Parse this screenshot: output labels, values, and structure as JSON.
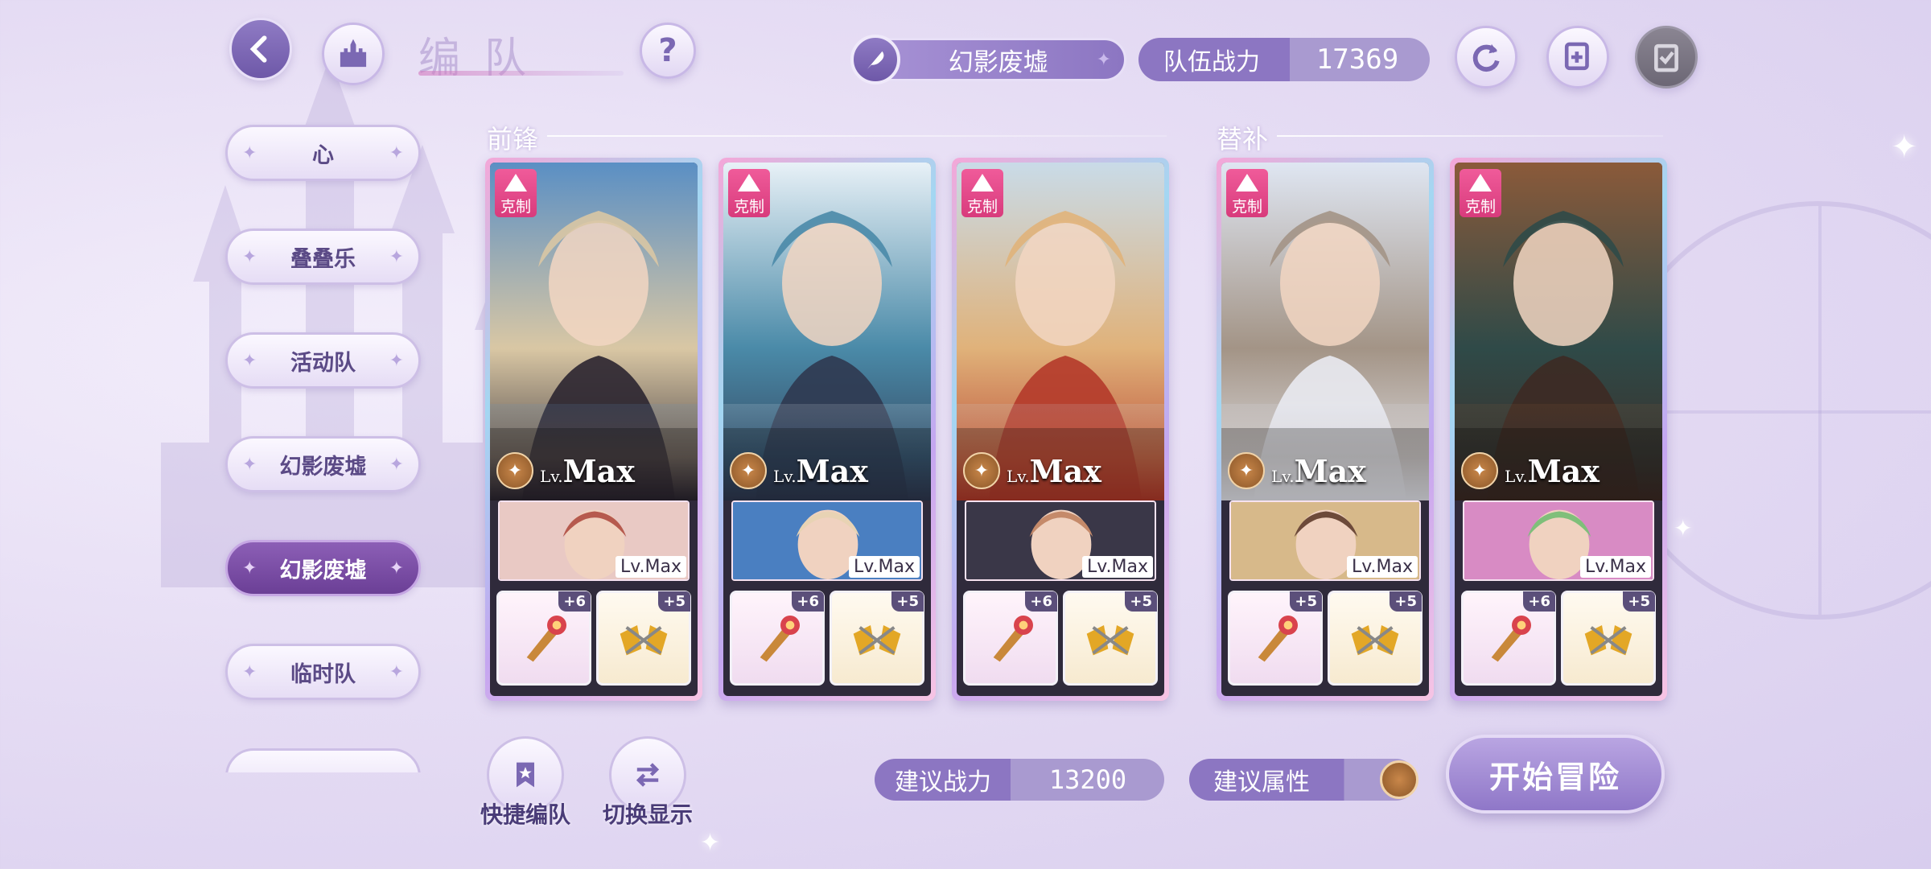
{
  "header": {
    "title": "编队",
    "stage_name": "幻影废墟",
    "power_label": "队伍战力",
    "power_value": "17369"
  },
  "sidebar": {
    "teams": [
      {
        "label": "心",
        "active": false
      },
      {
        "label": "叠叠乐",
        "active": false
      },
      {
        "label": "活动队",
        "active": false
      },
      {
        "label": "幻影废墟",
        "active": false
      },
      {
        "label": "幻影废墟",
        "active": true
      },
      {
        "label": "临时队",
        "active": false
      }
    ]
  },
  "sections": {
    "front_label": "前锋",
    "sub_label": "替补"
  },
  "cards": [
    {
      "badge": "克制",
      "lv_prefix": "Lv.",
      "lv_value": "Max",
      "support_lv": "Lv.Max",
      "equip1_lv": "+6",
      "equip2_lv": "+5",
      "portrait_colors": [
        "#5a8fc4",
        "#d9c7a4",
        "#2b2530"
      ],
      "support_colors": [
        "#e9c9c4",
        "#b65a4e"
      ]
    },
    {
      "badge": "克制",
      "lv_prefix": "Lv.",
      "lv_value": "Max",
      "support_lv": "Lv.Max",
      "equip1_lv": "+6",
      "equip2_lv": "+5",
      "portrait_colors": [
        "#e8f1f7",
        "#4a8aa8",
        "#2f3850"
      ],
      "support_colors": [
        "#4a7fc1",
        "#e8d3b4"
      ]
    },
    {
      "badge": "克制",
      "lv_prefix": "Lv.",
      "lv_value": "Max",
      "support_lv": "Lv.Max",
      "equip1_lv": "+6",
      "equip2_lv": "+5",
      "portrait_colors": [
        "#c9dbe8",
        "#e0b27a",
        "#b43a2a"
      ],
      "support_colors": [
        "#3a3748",
        "#c58a6a"
      ]
    },
    {
      "badge": "克制",
      "lv_prefix": "Lv.",
      "lv_value": "Max",
      "support_lv": "Lv.Max",
      "equip1_lv": "+5",
      "equip2_lv": "+5",
      "portrait_colors": [
        "#dfe6f2",
        "#a39486",
        "#e9eaf1"
      ],
      "support_colors": [
        "#d7b98a",
        "#6d4a3a"
      ]
    },
    {
      "badge": "克制",
      "lv_prefix": "Lv.",
      "lv_value": "Max",
      "support_lv": "Lv.Max",
      "equip1_lv": "+6",
      "equip2_lv": "+5",
      "portrait_colors": [
        "#8b5a3a",
        "#2f4a48",
        "#3d2a24"
      ],
      "support_colors": [
        "#d88bc4",
        "#7fbf7a"
      ]
    }
  ],
  "bottom": {
    "quick_team_label": "快捷编队",
    "switch_display_label": "切换显示",
    "rec_power_label": "建议战力",
    "rec_power_value": "13200",
    "rec_attr_label": "建议属性",
    "start_label": "开始冒险"
  },
  "colors": {
    "accent": "#8c76c2",
    "active_tab": "#7a4ca6",
    "badge": "#e84b8c"
  }
}
